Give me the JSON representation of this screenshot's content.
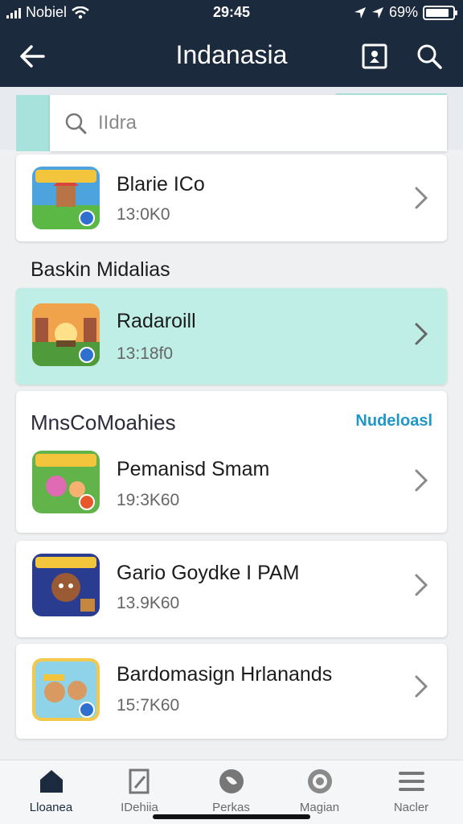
{
  "status_bar": {
    "carrier": "Nobiel",
    "time": "29:45",
    "battery": "69%"
  },
  "header": {
    "title": "Indanasia",
    "back_icon": "back-arrow-icon",
    "action_icons": [
      "bookmark-icon",
      "search-icon"
    ]
  },
  "search": {
    "value": "",
    "placeholder": "IIdra"
  },
  "top_item": {
    "name": "Blarie ICo",
    "meta": "13:0K0"
  },
  "section": {
    "title": "Baskin Midalias"
  },
  "highlighted_item": {
    "name": "Radaroill",
    "meta": "13:18f0"
  },
  "group": {
    "title": "MnsCoMoahies",
    "link": "Nudeloasl",
    "items": [
      {
        "name": "Pemanisd Smam",
        "meta": "19:3K60"
      },
      {
        "name": "Gario Goydke I PAM",
        "meta": "13.9K60"
      },
      {
        "name": "Bardomasign Hrlanands",
        "meta": "15:7K60"
      }
    ]
  },
  "bottom_nav": [
    {
      "label": "Lloanea",
      "icon": "home-icon",
      "active": true
    },
    {
      "label": "IDehiia",
      "icon": "document-icon",
      "active": false
    },
    {
      "label": "Perkas",
      "icon": "explore-icon",
      "active": false
    },
    {
      "label": "Magian",
      "icon": "profile-icon",
      "active": false
    },
    {
      "label": "Nacler",
      "icon": "menu-icon",
      "active": false
    }
  ],
  "colors": {
    "header_bg": "#1c2a3d",
    "accent": "#a8e2dc",
    "highlight": "#bfeee6",
    "link": "#1f98c8"
  }
}
